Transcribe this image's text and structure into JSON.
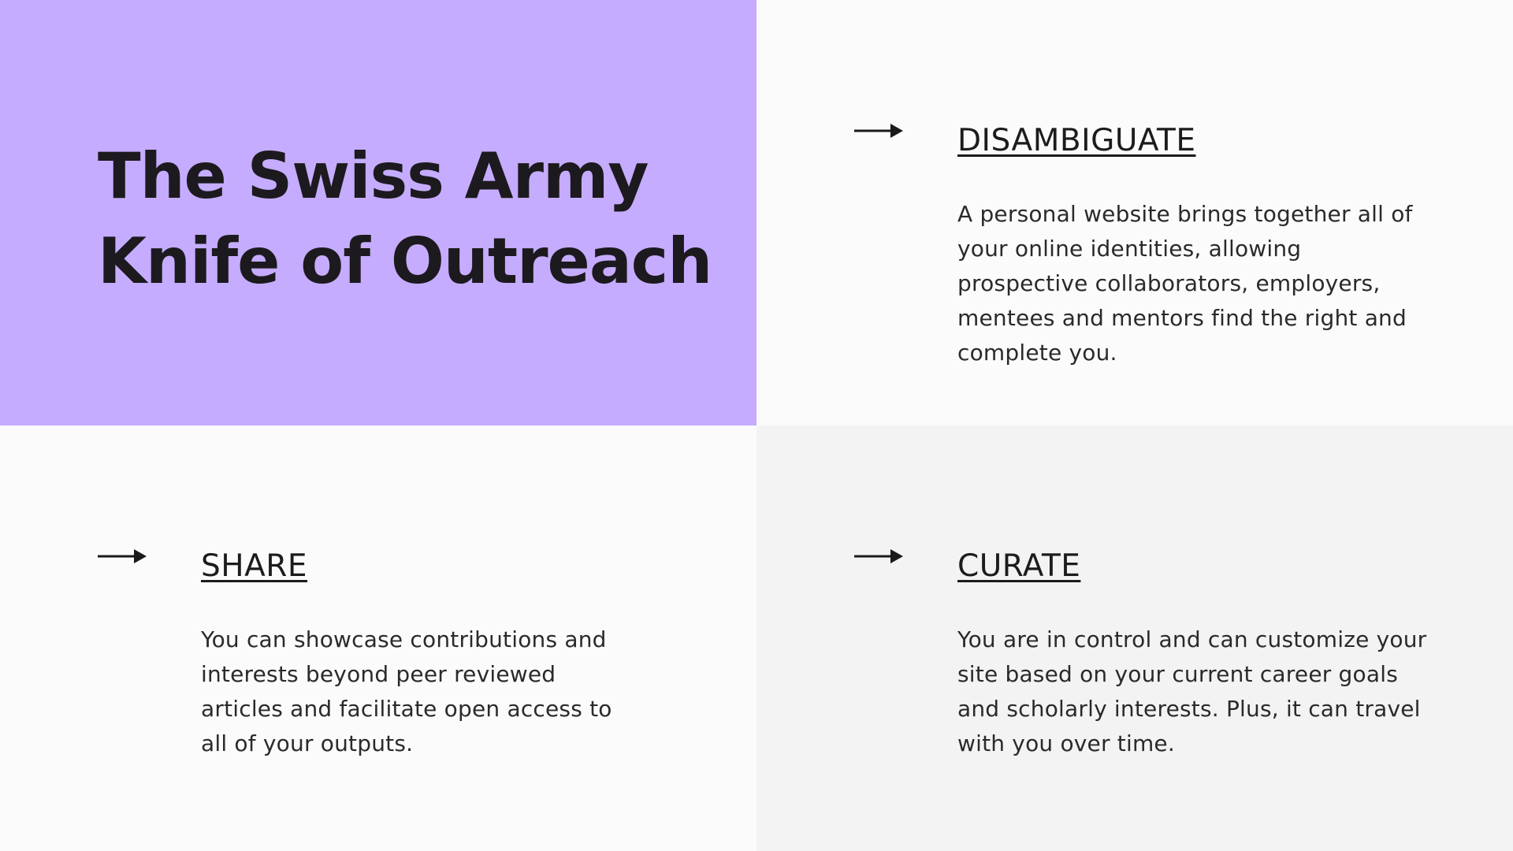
{
  "title": {
    "line1": "The Swiss Army",
    "line2": "Knife of Outreach"
  },
  "sections": {
    "disambiguate": {
      "heading": "DISAMBIGUATE",
      "body": "A personal website brings together all of your online identities, allowing prospective collaborators, employers, mentees and mentors find the right and complete you."
    },
    "share": {
      "heading": "SHARE",
      "body": "You can showcase contributions and interests beyond peer reviewed articles and facilitate open access to all of your outputs."
    },
    "curate": {
      "heading": "CURATE",
      "body": "You are in control and can customize your site based on your current career goals and scholarly interests. Plus, it can travel with you over time."
    }
  },
  "icons": {
    "arrow": "right-arrow-icon"
  },
  "colors": {
    "title_panel": "#c5acfe",
    "top_right_panel": "#fbfbfb",
    "bottom_left_panel": "#fbfbfb",
    "bottom_right_panel": "#f3f3f3",
    "text": "#1c1c1c"
  }
}
